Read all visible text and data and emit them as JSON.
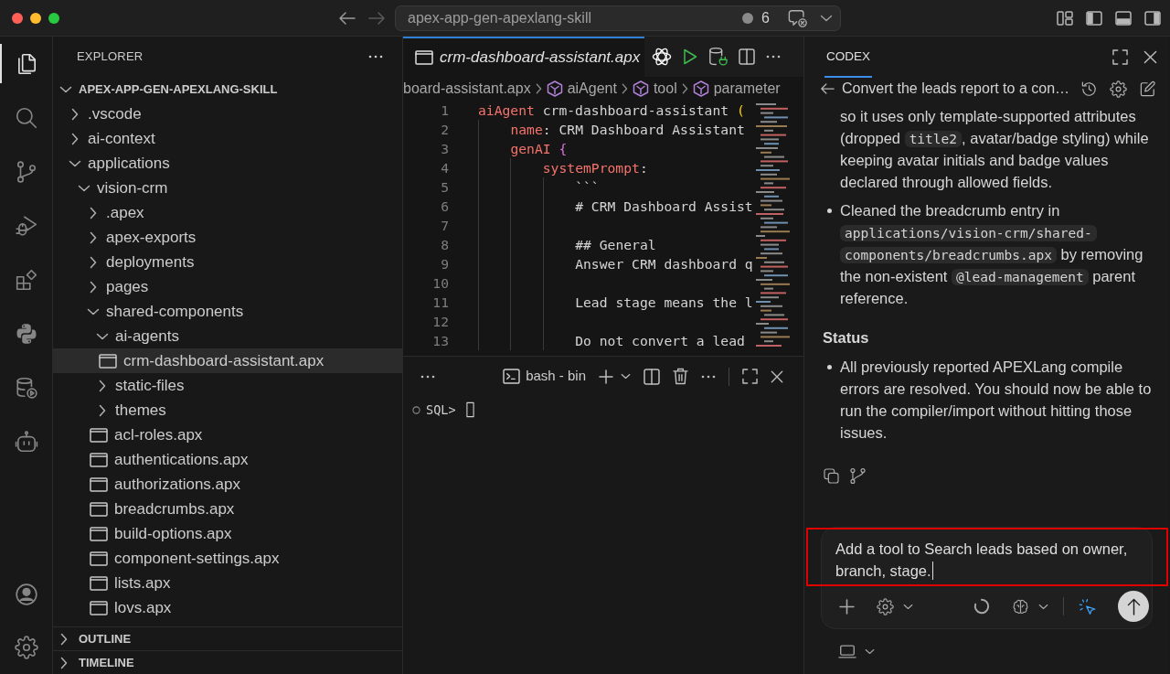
{
  "title_bar": {
    "search_text": "apex-app-gen-apexlang-skill",
    "status_count": "6"
  },
  "activity_bar": {
    "items": [
      {
        "kind": "files",
        "selected": true
      },
      {
        "kind": "search",
        "selected": false
      },
      {
        "kind": "source-control",
        "selected": false
      },
      {
        "kind": "run-debug",
        "selected": false
      },
      {
        "kind": "extensions",
        "selected": false
      },
      {
        "kind": "python",
        "selected": false
      },
      {
        "kind": "database",
        "selected": false
      },
      {
        "kind": "robot",
        "selected": false
      }
    ],
    "bottom_items": [
      {
        "kind": "account",
        "selected": false
      },
      {
        "kind": "settings",
        "selected": false
      }
    ]
  },
  "explorer": {
    "title": "EXPLORER",
    "root": {
      "label": "APEX-APP-GEN-APEXLANG-SKILL",
      "kind": "root",
      "expanded": true,
      "selected": false,
      "children": [
        {
          "label": ".vscode",
          "kind": "folder",
          "expanded": false,
          "selected": false
        },
        {
          "label": "ai-context",
          "kind": "folder",
          "expanded": false,
          "selected": false
        },
        {
          "label": "applications",
          "kind": "folder",
          "expanded": true,
          "selected": false,
          "children": [
            {
              "label": "vision-crm",
              "kind": "folder",
              "expanded": true,
              "selected": false,
              "children": [
                {
                  "label": ".apex",
                  "kind": "folder",
                  "expanded": false,
                  "selected": false
                },
                {
                  "label": "apex-exports",
                  "kind": "folder",
                  "expanded": false,
                  "selected": false
                },
                {
                  "label": "deployments",
                  "kind": "folder",
                  "expanded": false,
                  "selected": false
                },
                {
                  "label": "pages",
                  "kind": "folder",
                  "expanded": false,
                  "selected": false
                },
                {
                  "label": "shared-components",
                  "kind": "folder",
                  "expanded": true,
                  "selected": false,
                  "children": [
                    {
                      "label": "ai-agents",
                      "kind": "folder",
                      "expanded": true,
                      "selected": false,
                      "children": [
                        {
                          "label": "crm-dashboard-assistant.apx",
                          "kind": "file",
                          "selected": true
                        }
                      ]
                    },
                    {
                      "label": "static-files",
                      "kind": "folder",
                      "expanded": false,
                      "selected": false
                    },
                    {
                      "label": "themes",
                      "kind": "folder",
                      "expanded": false,
                      "selected": false
                    },
                    {
                      "label": "acl-roles.apx",
                      "kind": "file",
                      "selected": false
                    },
                    {
                      "label": "authentications.apx",
                      "kind": "file",
                      "selected": false
                    },
                    {
                      "label": "authorizations.apx",
                      "kind": "file",
                      "selected": false
                    },
                    {
                      "label": "breadcrumbs.apx",
                      "kind": "file",
                      "selected": false
                    },
                    {
                      "label": "build-options.apx",
                      "kind": "file",
                      "selected": false
                    },
                    {
                      "label": "component-settings.apx",
                      "kind": "file",
                      "selected": false
                    },
                    {
                      "label": "lists.apx",
                      "kind": "file",
                      "selected": false
                    },
                    {
                      "label": "lovs.apx",
                      "kind": "file",
                      "selected": false
                    }
                  ]
                }
              ]
            }
          ]
        }
      ]
    },
    "sections": [
      {
        "label": "OUTLINE",
        "expanded": false
      },
      {
        "label": "TIMELINE",
        "expanded": false
      }
    ]
  },
  "editor": {
    "tabs": [
      {
        "label": "crm-dashboard-assistant.apx",
        "selected": true,
        "preview": true
      }
    ],
    "breadcrumbs": [
      {
        "label": "board-assistant.apx",
        "kind": "file"
      },
      {
        "label": "aiAgent",
        "kind": "symbol"
      },
      {
        "label": "tool",
        "kind": "symbol"
      },
      {
        "label": "parameter",
        "kind": "symbol"
      }
    ],
    "lines": [
      {
        "number": "1",
        "tokens": [
          {
            "text": "aiAgent",
            "kind": "keyword"
          },
          {
            "text": " crm-dashboard-assistant ",
            "kind": "text"
          },
          {
            "text": "(",
            "kind": "bracket1"
          }
        ],
        "children": [
          {
            "number": "2",
            "tokens": [
              {
                "text": "name",
                "kind": "keyword"
              },
              {
                "text": ": CRM Dashboard Assistant",
                "kind": "text"
              }
            ]
          },
          {
            "number": "3",
            "tokens": [
              {
                "text": "genAI",
                "kind": "keyword"
              },
              {
                "text": " {",
                "kind": "bracket2"
              }
            ],
            "children": [
              {
                "number": "4",
                "tokens": [
                  {
                    "text": "systemPrompt",
                    "kind": "keyword"
                  },
                  {
                    "text": ":",
                    "kind": "text"
                  }
                ],
                "children": [
                  {
                    "number": "5",
                    "tokens": [
                      {
                        "text": "```",
                        "kind": "text"
                      }
                    ]
                  },
                  {
                    "number": "6",
                    "tokens": [
                      {
                        "text": "# CRM Dashboard Assist",
                        "kind": "text"
                      }
                    ]
                  },
                  {
                    "number": "7"
                  },
                  {
                    "number": "8",
                    "tokens": [
                      {
                        "text": "## General",
                        "kind": "text"
                      }
                    ]
                  },
                  {
                    "number": "9",
                    "tokens": [
                      {
                        "text": "Answer CRM dashboard q",
                        "kind": "text"
                      }
                    ]
                  },
                  {
                    "number": "10"
                  },
                  {
                    "number": "11",
                    "tokens": [
                      {
                        "text": "Lead stage means the l",
                        "kind": "text"
                      }
                    ]
                  },
                  {
                    "number": "12"
                  },
                  {
                    "number": "13",
                    "tokens": [
                      {
                        "text": "Do not convert a lead",
                        "kind": "text"
                      }
                    ]
                  }
                ]
              }
            ]
          }
        ]
      }
    ]
  },
  "terminal": {
    "tab_label": "bash - bin",
    "prompt": "SQL>"
  },
  "codex": {
    "tabs": [
      {
        "label": "CODEX",
        "selected": true
      }
    ],
    "thread_title": "Convert the leads report to a con…",
    "blocks": [
      {
        "kind": "paragraph",
        "segments": [
          {
            "text": "so it uses only template-supported attributes (dropped ",
            "code": false
          },
          {
            "text": "title2",
            "code": true
          },
          {
            "text": ", avatar/badge styling) while keeping avatar initials and badge values declared through allowed fields.",
            "code": false
          }
        ]
      },
      {
        "kind": "bullet",
        "segments": [
          {
            "text": "Cleaned the breadcrumb entry in ",
            "code": false
          },
          {
            "text": "applications/vision-crm/shared-components/breadcrumbs.apx",
            "code": true
          },
          {
            "text": " by removing the non-existent ",
            "code": false
          },
          {
            "text": "@lead-management",
            "code": true
          },
          {
            "text": " parent reference.",
            "code": false
          }
        ]
      },
      {
        "kind": "heading",
        "segments": [
          {
            "text": "Status",
            "code": false
          }
        ]
      },
      {
        "kind": "bullet",
        "segments": [
          {
            "text": "All previously reported APEXLang compile errors are resolved. You should now be able to run the compiler/import without hitting those issues.",
            "code": false
          }
        ]
      }
    ],
    "composer": {
      "value": "Add a tool to Search leads based on owner, branch, stage.",
      "highlighted": true
    }
  }
}
